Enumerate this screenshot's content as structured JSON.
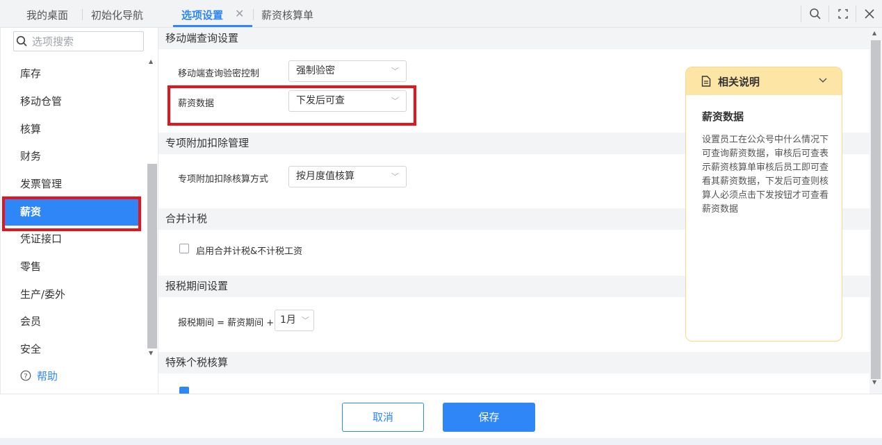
{
  "tabs": [
    {
      "label": "我的桌面"
    },
    {
      "label": "初始化导航"
    },
    {
      "label": "选项设置"
    },
    {
      "label": "薪资核算单"
    }
  ],
  "tab_close_glyph": "✕",
  "window_controls": [
    "search-icon",
    "fullscreen-icon",
    "close-icon"
  ],
  "sidebar": {
    "search_placeholder": "选项搜索",
    "items": [
      {
        "label": "库存"
      },
      {
        "label": "移动仓管"
      },
      {
        "label": "核算"
      },
      {
        "label": "财务"
      },
      {
        "label": "发票管理"
      },
      {
        "label": "薪资"
      },
      {
        "label": "凭证接口"
      },
      {
        "label": "零售"
      },
      {
        "label": "生产/委外"
      },
      {
        "label": "会员"
      },
      {
        "label": "安全"
      }
    ],
    "help_label": "帮助"
  },
  "main": {
    "sections": {
      "mobile_query": {
        "title": "移动端查询设置",
        "verify_label": "移动端查询验密控制",
        "verify_value": "强制验密",
        "salary_label": "薪资数据",
        "salary_value": "下发后可查"
      },
      "special_deduction": {
        "title": "专项附加扣除管理",
        "method_label": "专项附加扣除核算方式",
        "method_value": "按月度值核算"
      },
      "combined_tax": {
        "title": "合并计税",
        "checkbox_label": "启用合并计税&不计税工资"
      },
      "tax_period": {
        "title": "报税期间设置",
        "formula_label": "报税期间 = 薪资期间 +",
        "month_value": "1月"
      },
      "special_tax": {
        "title": "特殊个税核算"
      }
    }
  },
  "info_panel": {
    "header": "相关说明",
    "title": "薪资数据",
    "body": "设置员工在公众号中什么情况下可查询薪资数据，审核后可查表示薪资核算单审核后员工即可查看其薪资数据，下发后可查则核算人必须点击下发按钮才可查看薪资数据"
  },
  "footer": {
    "cancel_label": "取消",
    "save_label": "保存"
  },
  "colors": {
    "accent": "#2f86f6",
    "highlight_red": "#e8131b",
    "info_header_bg": "#fde5a6"
  }
}
